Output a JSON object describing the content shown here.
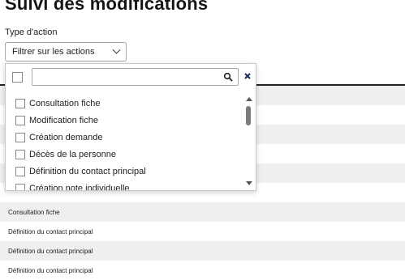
{
  "page": {
    "title": "Suivi des modifications"
  },
  "filter": {
    "label": "Type d'action",
    "select_value": "Filtrer sur les actions",
    "search_placeholder": "",
    "options": [
      "Consultation fiche",
      "Modification fiche",
      "Création demande",
      "Décès de la personne",
      "Définition du contact principal",
      "Création note individuelle"
    ]
  },
  "table": {
    "rows": [
      "",
      "",
      "",
      "",
      "",
      "",
      "Consultation fiche",
      "Définition du contact principal",
      "Définition du contact principal",
      "Définition du contact principal"
    ]
  },
  "icons": {
    "search": "search-icon",
    "clear": "close-icon",
    "chevron": "chevron-down-icon"
  },
  "colors": {
    "row_alt": "#efefef",
    "header_rule": "#222222"
  }
}
